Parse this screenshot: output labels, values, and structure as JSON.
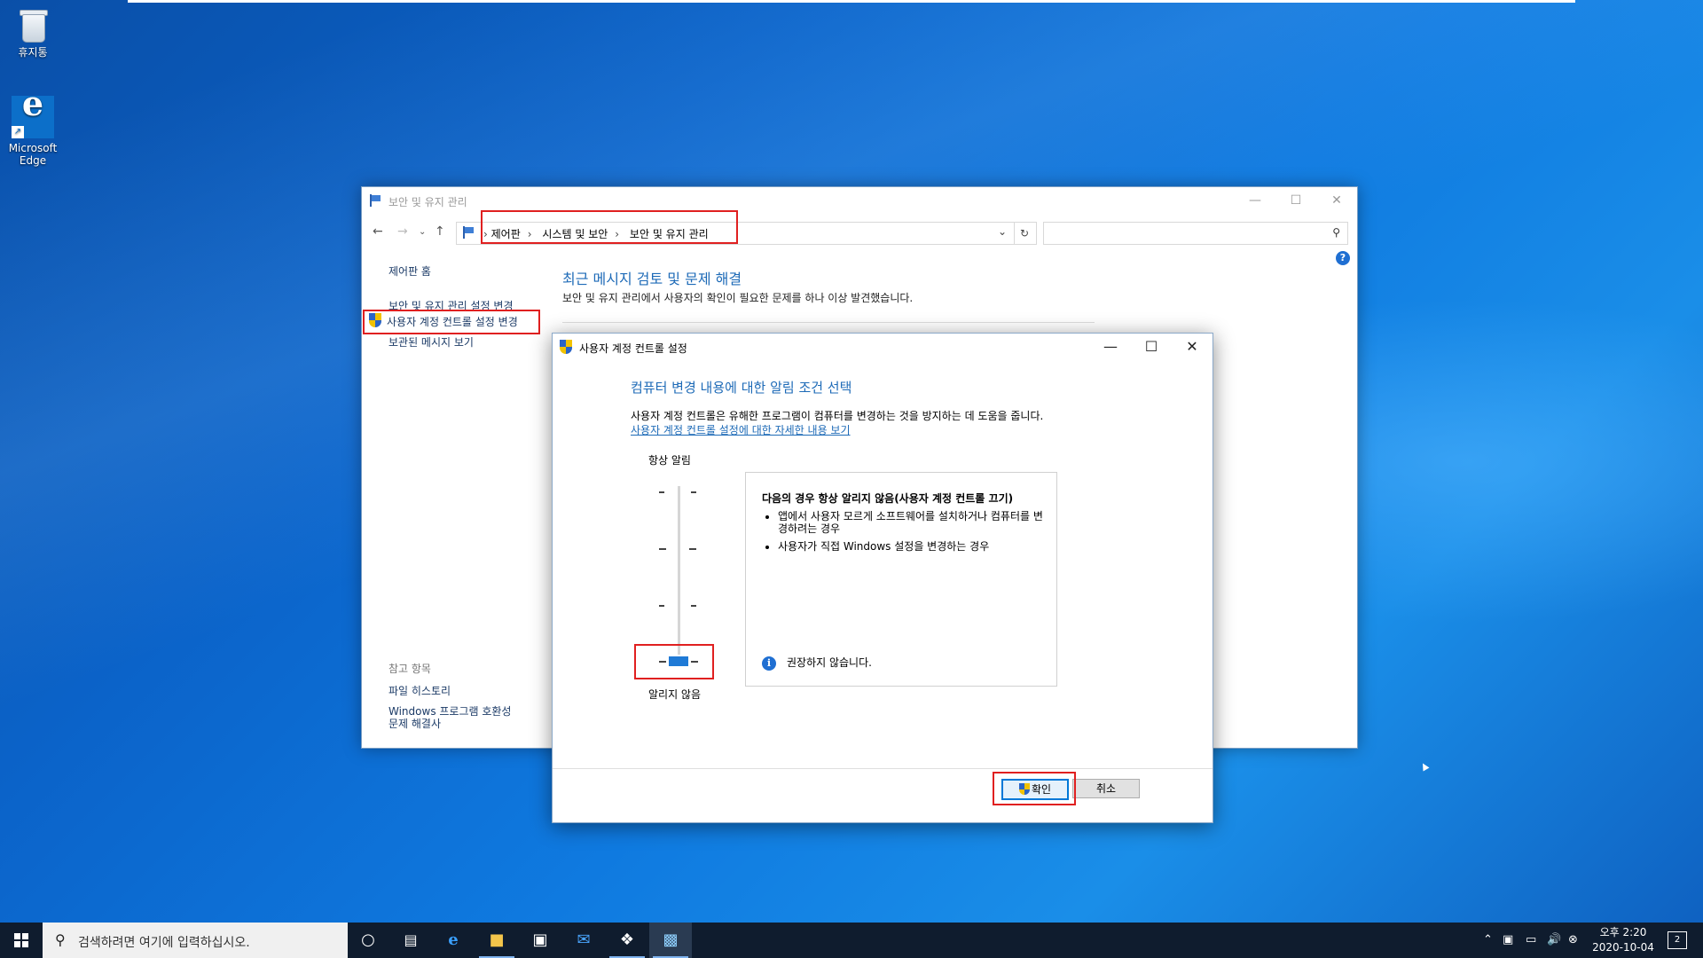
{
  "desktop": {
    "icons": [
      {
        "label": "휴지통"
      },
      {
        "label": "Microsoft Edge"
      }
    ]
  },
  "main_window": {
    "title": "보안 및 유지 관리",
    "breadcrumb": [
      "제어판",
      "시스템 및 보안",
      "보안 및 유지 관리"
    ],
    "search_placeholder": "",
    "help": "?",
    "left_nav": {
      "home": "제어판 홈",
      "settings": "보안 및 유지 관리 설정 변경",
      "uac": "사용자 계정 컨트롤 설정 변경",
      "archived": "보관된 메시지 보기"
    },
    "see_also": {
      "header": "참고 항목",
      "file_history": "파일 히스토리",
      "compat": "Windows 프로그램 호환성 문제 해결사"
    },
    "heading": "최근 메시지 검토 및 문제 해결",
    "subheading": "보안 및 유지 관리에서 사용자의 확인이 필요한 문제를 하나 이상 발견했습니다."
  },
  "uac_dialog": {
    "title": "사용자 계정 컨트롤 설정",
    "heading": "컴퓨터 변경 내용에 대한 알림 조건 선택",
    "description": "사용자 계정 컨트롤은 유해한 프로그램이 컴퓨터를 변경하는 것을 방지하는 데 도움을 줍니다.",
    "link": "사용자 계정 컨트롤 설정에 대한 자세한 내용 보기",
    "slider_top_label": "항상 알림",
    "slider_bottom_label": "알리지 않음",
    "slider_level": 0,
    "slider_levels": 4,
    "info_header": "다음의 경우 항상 알리지 않음(사용자 계정 컨트롤 끄기)",
    "info_items": [
      "앱에서 사용자 모르게 소프트웨어를 설치하거나 컴퓨터를 변경하려는 경우",
      "사용자가 직접 Windows 설정을 변경하는 경우"
    ],
    "info_note": "권장하지 않습니다.",
    "ok_label": "확인",
    "cancel_label": "취소"
  },
  "taskbar": {
    "search_placeholder": "검색하려면 여기에 입력하십시오.",
    "time": "오후 2:20",
    "date": "2020-10-04",
    "notification_count": "2",
    "icons": [
      "start-icon",
      "cortana-icon",
      "task-view-icon",
      "edge-icon",
      "file-explorer-icon",
      "store-icon",
      "mail-icon",
      "app-icon",
      "control-panel-icon"
    ]
  },
  "colors": {
    "accent": "#1d6ab7",
    "highlight_box": "#e02020",
    "taskbar": "#0f1c2e"
  }
}
